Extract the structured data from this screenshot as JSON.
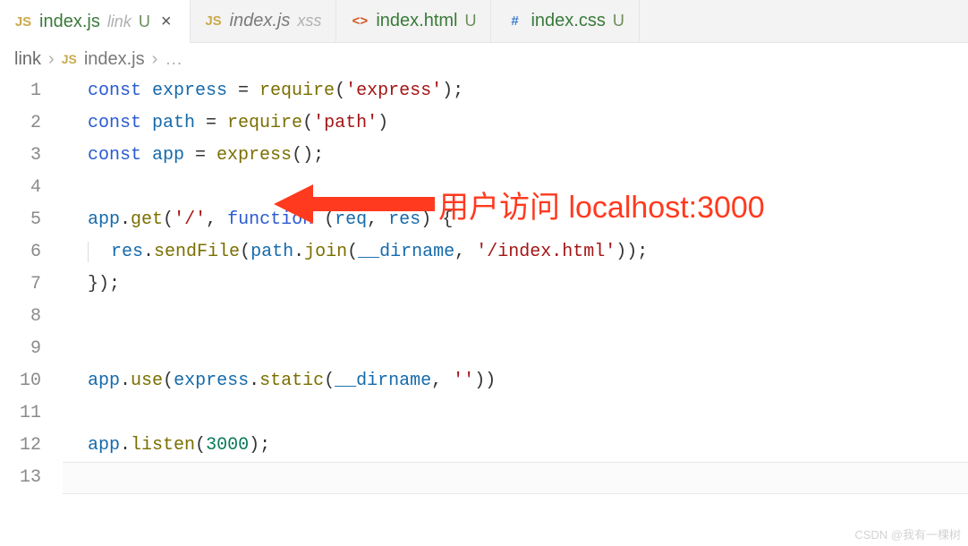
{
  "tabs": [
    {
      "icon": "JS",
      "iconClass": "icon-js",
      "name": "index.js",
      "folder": "link",
      "status": "U",
      "active": true,
      "dim": false,
      "closeVisible": true
    },
    {
      "icon": "JS",
      "iconClass": "icon-js",
      "name": "index.js",
      "folder": "xss",
      "status": "",
      "active": false,
      "dim": true,
      "closeVisible": false
    },
    {
      "icon": "<>",
      "iconClass": "icon-html",
      "name": "index.html",
      "folder": "",
      "status": "U",
      "active": false,
      "dim": false,
      "closeVisible": false
    },
    {
      "icon": "#",
      "iconClass": "icon-css",
      "name": "index.css",
      "folder": "",
      "status": "U",
      "active": false,
      "dim": false,
      "closeVisible": false
    }
  ],
  "breadcrumb": {
    "folder": "link",
    "icon": "JS",
    "file": "index.js",
    "more": "…"
  },
  "annotation": {
    "text": "用户访问 localhost:3000"
  },
  "watermark": "CSDN @我有一棵树",
  "code": {
    "lines": [
      {
        "n": 1,
        "tokens": [
          {
            "t": "const ",
            "c": "kw"
          },
          {
            "t": "express",
            "c": "var"
          },
          {
            "t": " = ",
            "c": "punct"
          },
          {
            "t": "require",
            "c": "call"
          },
          {
            "t": "(",
            "c": "punct"
          },
          {
            "t": "'express'",
            "c": "str"
          },
          {
            "t": ");",
            "c": "punct"
          }
        ]
      },
      {
        "n": 2,
        "tokens": [
          {
            "t": "const ",
            "c": "kw"
          },
          {
            "t": "path",
            "c": "var"
          },
          {
            "t": " = ",
            "c": "punct"
          },
          {
            "t": "require",
            "c": "call"
          },
          {
            "t": "(",
            "c": "punct"
          },
          {
            "t": "'path'",
            "c": "str"
          },
          {
            "t": ")",
            "c": "punct"
          }
        ]
      },
      {
        "n": 3,
        "tokens": [
          {
            "t": "const ",
            "c": "kw"
          },
          {
            "t": "app",
            "c": "var"
          },
          {
            "t": " = ",
            "c": "punct"
          },
          {
            "t": "express",
            "c": "call"
          },
          {
            "t": "();",
            "c": "punct"
          }
        ]
      },
      {
        "n": 4,
        "tokens": []
      },
      {
        "n": 5,
        "tokens": [
          {
            "t": "app",
            "c": "obj"
          },
          {
            "t": ".",
            "c": "punct"
          },
          {
            "t": "get",
            "c": "call"
          },
          {
            "t": "(",
            "c": "punct"
          },
          {
            "t": "'/'",
            "c": "str"
          },
          {
            "t": ", ",
            "c": "punct"
          },
          {
            "t": "function ",
            "c": "kw"
          },
          {
            "t": "(",
            "c": "punct"
          },
          {
            "t": "req",
            "c": "param"
          },
          {
            "t": ", ",
            "c": "punct"
          },
          {
            "t": "res",
            "c": "param"
          },
          {
            "t": ") {",
            "c": "punct"
          }
        ]
      },
      {
        "n": 6,
        "indent": 1,
        "guide": true,
        "tokens": [
          {
            "t": "res",
            "c": "obj"
          },
          {
            "t": ".",
            "c": "punct"
          },
          {
            "t": "sendFile",
            "c": "call"
          },
          {
            "t": "(",
            "c": "punct"
          },
          {
            "t": "path",
            "c": "obj"
          },
          {
            "t": ".",
            "c": "punct"
          },
          {
            "t": "join",
            "c": "call"
          },
          {
            "t": "(",
            "c": "punct"
          },
          {
            "t": "__dirname",
            "c": "builtin"
          },
          {
            "t": ", ",
            "c": "punct"
          },
          {
            "t": "'/index.html'",
            "c": "str"
          },
          {
            "t": "));",
            "c": "punct"
          }
        ]
      },
      {
        "n": 7,
        "tokens": [
          {
            "t": "});",
            "c": "punct"
          }
        ]
      },
      {
        "n": 8,
        "tokens": []
      },
      {
        "n": 9,
        "tokens": []
      },
      {
        "n": 10,
        "tokens": [
          {
            "t": "app",
            "c": "obj"
          },
          {
            "t": ".",
            "c": "punct"
          },
          {
            "t": "use",
            "c": "call"
          },
          {
            "t": "(",
            "c": "punct"
          },
          {
            "t": "express",
            "c": "obj"
          },
          {
            "t": ".",
            "c": "punct"
          },
          {
            "t": "static",
            "c": "call"
          },
          {
            "t": "(",
            "c": "punct"
          },
          {
            "t": "__dirname",
            "c": "builtin"
          },
          {
            "t": ", ",
            "c": "punct"
          },
          {
            "t": "''",
            "c": "str"
          },
          {
            "t": "))",
            "c": "punct"
          }
        ]
      },
      {
        "n": 11,
        "tokens": []
      },
      {
        "n": 12,
        "tokens": [
          {
            "t": "app",
            "c": "obj"
          },
          {
            "t": ".",
            "c": "punct"
          },
          {
            "t": "listen",
            "c": "call"
          },
          {
            "t": "(",
            "c": "punct"
          },
          {
            "t": "3000",
            "c": "num"
          },
          {
            "t": ");",
            "c": "punct"
          }
        ]
      },
      {
        "n": 13,
        "tokens": [],
        "current": true
      }
    ]
  }
}
